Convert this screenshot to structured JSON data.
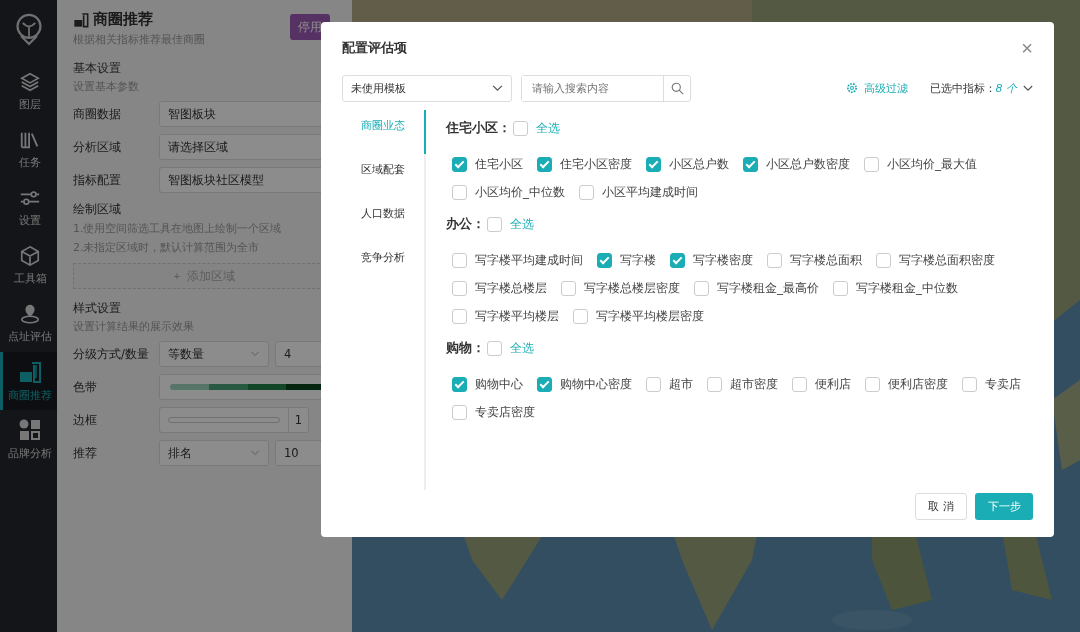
{
  "sidebar": {
    "items": [
      {
        "label": "图层",
        "selected": false
      },
      {
        "label": "任务",
        "selected": false
      },
      {
        "label": "设置",
        "selected": false
      },
      {
        "label": "工具箱",
        "selected": false
      },
      {
        "label": "点址评估",
        "selected": false
      },
      {
        "label": "商圈推荐",
        "selected": true
      },
      {
        "label": "品牌分析",
        "selected": false
      }
    ]
  },
  "panel": {
    "title": "商圈推荐",
    "subtitle": "根据相关指标推荐最佳商圈",
    "disable_button": "停用",
    "basic": {
      "heading": "基本设置",
      "hint": "设置基本参数"
    },
    "fields": [
      {
        "label": "商圈数据",
        "value": "智图板块"
      },
      {
        "label": "分析区域",
        "value": "请选择区域"
      },
      {
        "label": "指标配置",
        "value": "智图板块社区模型"
      }
    ],
    "draw": {
      "heading": "绘制区域",
      "notes": [
        "1.使用空间筛选工具在地图上绘制一个区域",
        "2.未指定区域时，默认计算范围为全市"
      ],
      "add_icon": "+",
      "add_label": "添加区域"
    },
    "style": {
      "heading": "样式设置",
      "hint": "设置计算结果的展示效果",
      "rows": [
        {
          "label": "分级方式/数量",
          "kind": "double-select",
          "values": [
            "等数量",
            "4"
          ]
        },
        {
          "label": "色带",
          "kind": "ramp"
        },
        {
          "label": "边框",
          "kind": "slider",
          "value": "1"
        },
        {
          "label": "推荐",
          "kind": "double-select",
          "values": [
            "排名",
            "10"
          ]
        }
      ]
    }
  },
  "dialog": {
    "title": "配置评估项",
    "close": "×",
    "template": "未使用模板",
    "search_placeholder": "请输入搜索内容",
    "advanced_filter": "高级过滤",
    "selected_label": "已选中指标：",
    "selected_count": "8 个",
    "tabs": [
      {
        "label": "商圈业态",
        "selected": true
      },
      {
        "label": "区域配套",
        "selected": false
      },
      {
        "label": "人口数据",
        "selected": false
      },
      {
        "label": "竞争分析",
        "selected": false
      }
    ],
    "groups": [
      {
        "title": "住宅小区：",
        "checked": false,
        "select_all": "全选",
        "items": [
          {
            "label": "住宅小区",
            "checked": true
          },
          {
            "label": "住宅小区密度",
            "checked": true
          },
          {
            "label": "小区总户数",
            "checked": true
          },
          {
            "label": "小区总户数密度",
            "checked": true
          },
          {
            "label": "小区均价_最大值",
            "checked": false
          },
          {
            "label": "小区均价_中位数",
            "checked": false
          },
          {
            "label": "小区平均建成时间",
            "checked": false
          }
        ]
      },
      {
        "title": "办公：",
        "checked": false,
        "select_all": "全选",
        "items": [
          {
            "label": "写字楼平均建成时间",
            "checked": false
          },
          {
            "label": "写字楼",
            "checked": true
          },
          {
            "label": "写字楼密度",
            "checked": true
          },
          {
            "label": "写字楼总面积",
            "checked": false
          },
          {
            "label": "写字楼总面积密度",
            "checked": false
          },
          {
            "label": "写字楼总楼层",
            "checked": false
          },
          {
            "label": "写字楼总楼层密度",
            "checked": false
          },
          {
            "label": "写字楼租金_最高价",
            "checked": false
          },
          {
            "label": "写字楼租金_中位数",
            "checked": false
          },
          {
            "label": "写字楼平均楼层",
            "checked": false
          },
          {
            "label": "写字楼平均楼层密度",
            "checked": false
          }
        ]
      },
      {
        "title": "购物：",
        "checked": false,
        "select_all": "全选",
        "items": [
          {
            "label": "购物中心",
            "checked": true
          },
          {
            "label": "购物中心密度",
            "checked": true
          },
          {
            "label": "超市",
            "checked": false
          },
          {
            "label": "超市密度",
            "checked": false
          },
          {
            "label": "便利店",
            "checked": false
          },
          {
            "label": "便利店密度",
            "checked": false
          },
          {
            "label": "专卖店",
            "checked": false
          },
          {
            "label": "专卖店密度",
            "checked": false
          }
        ]
      }
    ],
    "cancel": "取 消",
    "next": "下一步"
  }
}
